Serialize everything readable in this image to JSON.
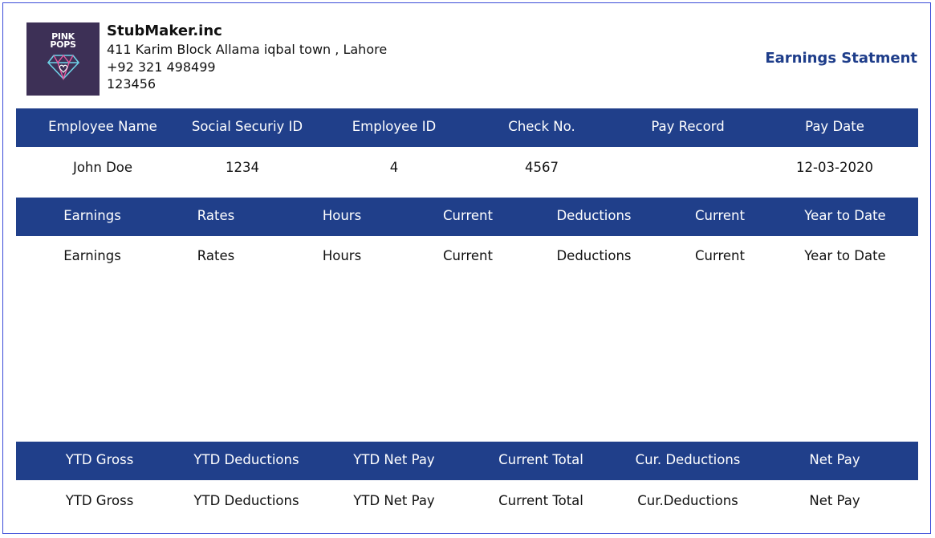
{
  "company": {
    "logo_text_line1": "PINK",
    "logo_text_line2": "POPS",
    "name": "StubMaker.inc",
    "address": "411 Karim Block Allama iqbal town , Lahore",
    "phone": "+92 321 498499",
    "code": "123456"
  },
  "statement_title": "Earnings Statment",
  "employee_table": {
    "headers": [
      "Employee Name",
      "Social Securiy ID",
      "Employee ID",
      "Check No.",
      "Pay Record",
      "Pay Date"
    ],
    "values": [
      "John Doe",
      "1234",
      "4",
      "4567",
      "",
      "12-03-2020"
    ]
  },
  "earnings_table": {
    "headers": [
      "Earnings",
      "Rates",
      "Hours",
      "Current",
      "Deductions",
      "Current",
      "Year to Date"
    ],
    "values": [
      "Earnings",
      "Rates",
      "Hours",
      "Current",
      "Deductions",
      "Current",
      "Year to Date"
    ]
  },
  "totals_table": {
    "headers": [
      "YTD Gross",
      "YTD Deductions",
      "YTD Net Pay",
      "Current Total",
      "Cur. Deductions",
      "Net Pay"
    ],
    "values": [
      "YTD Gross",
      "YTD Deductions",
      "YTD Net Pay",
      "Current Total",
      "Cur.Deductions",
      "Net Pay"
    ]
  },
  "colors": {
    "header_bar": "#203f8a",
    "title_accent": "#1e3d8a",
    "logo_bg": "#3d3056",
    "frame_border": "#3b4bd8"
  }
}
